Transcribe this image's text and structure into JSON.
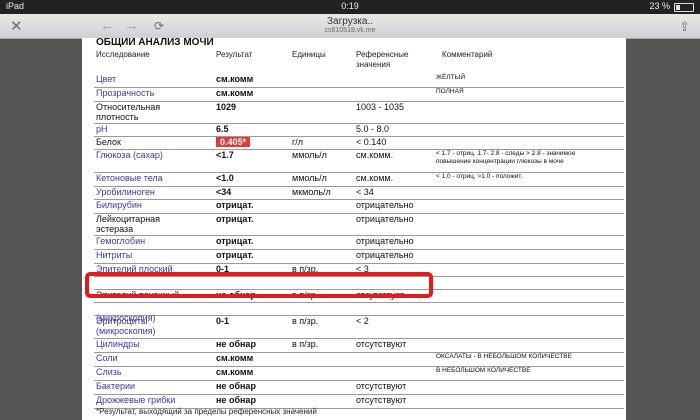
{
  "status": {
    "device": "iPad",
    "carrier_icon": "wifi-icon",
    "time": "0:19",
    "battery": "23 %",
    "battery_level": 0.23
  },
  "nav": {
    "title": "Загрузка..",
    "subtitle": "cs610518.vk.me"
  },
  "doc": {
    "title": "ОБЩИЙ АНАЛИЗ МОЧИ",
    "headers": {
      "name": "Исследование",
      "result": "Результат",
      "units": "Единицы",
      "ref": "Референсные\nзначения",
      "comment": "Комментарий"
    },
    "rows": [
      {
        "name": "Цвет",
        "result": "см.комм",
        "unit": "",
        "ref": "",
        "comment": "ЖЁЛТЫЙ"
      },
      {
        "name": "Прозрачность",
        "result": "см.комм",
        "unit": "",
        "ref": "",
        "comment": "ПОЛНАЯ"
      },
      {
        "name": "Относительная\nплотность",
        "result": "1029",
        "unit": "",
        "ref": "1003 - 1035",
        "comment": ""
      },
      {
        "name": "pH",
        "result": "6.5",
        "unit": "",
        "ref": "5.0 - 8.0",
        "comment": ""
      },
      {
        "name": "Белок",
        "result": "0.405*",
        "unit": "г/л",
        "ref": "< 0.140",
        "comment": ""
      },
      {
        "name": "Глюкоза (сахар)",
        "result": "<1.7",
        "unit": "ммоль/л",
        "ref": "см.комм.",
        "comment": "< 1.7 - отриц. 1.7- 2.8 - следы > 2.8 - значимое\nповышение концентрации глюкозы в моче"
      },
      {
        "name": "Кетоновые тела",
        "result": "<1.0",
        "unit": "ммоль/л",
        "ref": "см.комм.",
        "comment": "< 1,0 - отриц. >1.0 - положит."
      },
      {
        "name": "Уробилиноген",
        "result": "<34",
        "unit": "мкмоль/л",
        "ref": "< 34",
        "comment": ""
      },
      {
        "name": "Билирубин",
        "result": "отрицат.",
        "unit": "",
        "ref": "отрицательно",
        "comment": ""
      },
      {
        "name": "Лейкоцитарная\nэстераза",
        "result": "отрицат.",
        "unit": "",
        "ref": "отрицательно",
        "comment": ""
      },
      {
        "name": "Гемоглобин",
        "result": "отрицат.",
        "unit": "",
        "ref": "отрицательно",
        "comment": ""
      },
      {
        "name": "Нитриты",
        "result": "отрицат.",
        "unit": "",
        "ref": "отрицательно",
        "comment": ""
      },
      {
        "name": "Эпителий плоский",
        "result": "0-1",
        "unit": "в п/зр.",
        "ref": "< 3",
        "comment": ""
      },
      {
        "name": "",
        "result": "",
        "unit": "",
        "ref": "",
        "comment": ""
      },
      {
        "name": "Эпителий почечный",
        "result": "не обнар",
        "unit": "в п/зр.",
        "ref": "отсутствует",
        "comment": ""
      },
      {
        "name": "\n(микроскопия)",
        "result": "",
        "unit": "",
        "ref": "",
        "comment": ""
      },
      {
        "name": "Эритроциты\n(микроскопия)",
        "result": "0-1",
        "unit": "в п/зр.",
        "ref": "< 2",
        "comment": ""
      },
      {
        "name": "Цилиндры",
        "result": "не обнар",
        "unit": "в п/зр.",
        "ref": "отсутствуют",
        "comment": ""
      },
      {
        "name": "Соли",
        "result": "см.комм",
        "unit": "",
        "ref": "",
        "comment": "ОКСАЛАТЫ - В НЕБОЛЬШОМ КОЛИЧЕСТВЕ"
      },
      {
        "name": "Слизь",
        "result": "см.комм",
        "unit": "",
        "ref": "",
        "comment": "В НЕБОЛЬШОМ КОЛИЧЕСТВЕ"
      },
      {
        "name": "Бактерии",
        "result": "не обнар",
        "unit": "",
        "ref": "отсутствуют",
        "comment": ""
      },
      {
        "name": "Дрожжевые грибки",
        "result": "не обнар",
        "unit": "",
        "ref": "отсутствуют",
        "comment": ""
      }
    ],
    "footnote": "*Результат, выходящий за пределы референсных значений"
  }
}
